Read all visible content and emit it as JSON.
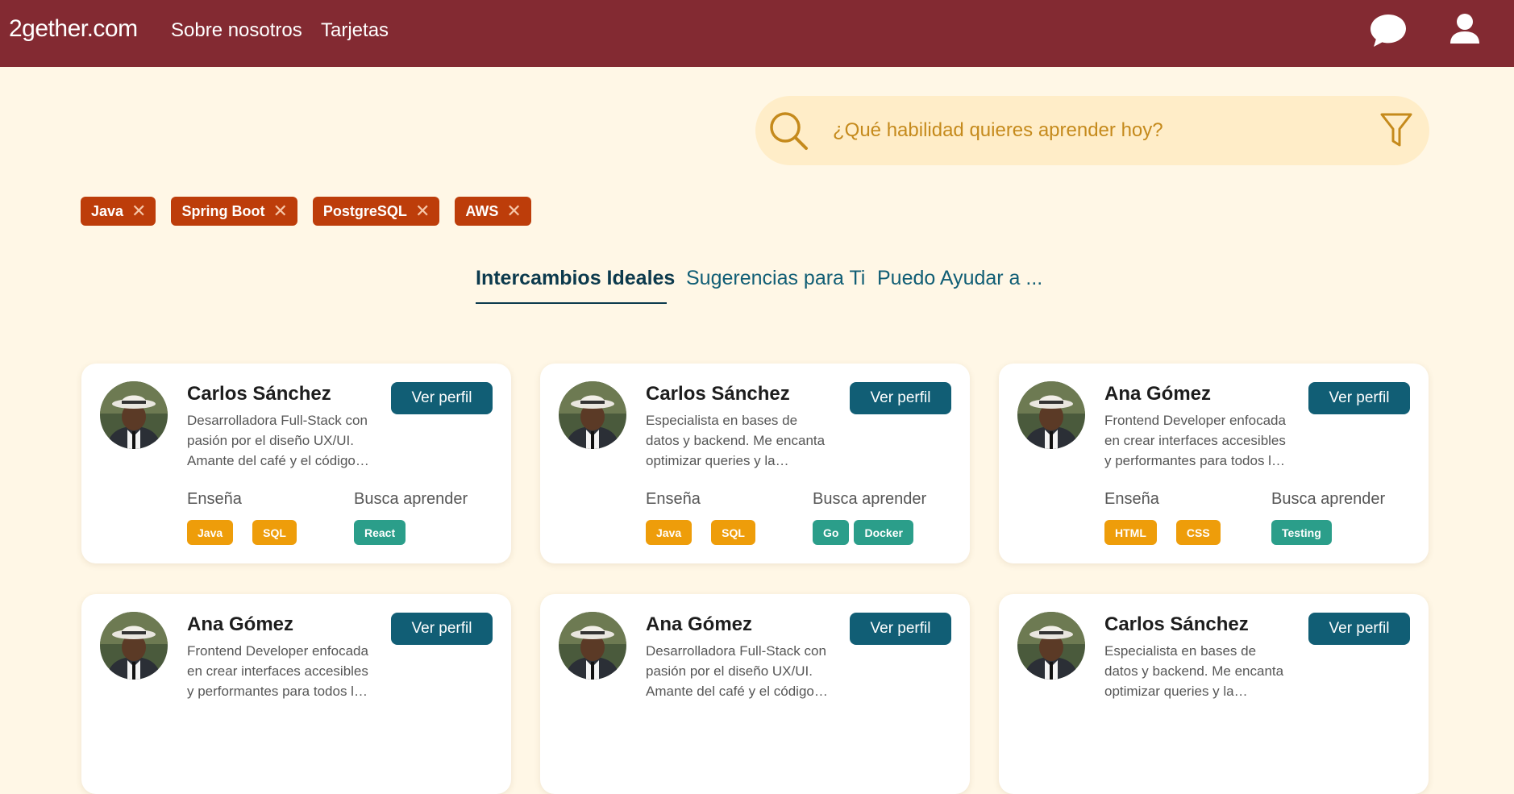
{
  "header": {
    "brand": "2gether.com",
    "nav": [
      "Sobre nosotros",
      "Tarjetas"
    ],
    "icons": [
      "chat-icon",
      "user-icon"
    ]
  },
  "search": {
    "placeholder": "¿Qué habilidad quieres aprender hoy?",
    "value": ""
  },
  "chips": [
    "Java",
    "Spring Boot",
    "PostgreSQL",
    "AWS"
  ],
  "tabs": [
    {
      "label": "Intercambios Ideales",
      "active": true
    },
    {
      "label": "Sugerencias para Ti",
      "active": false
    },
    {
      "label": "Puedo Ayudar a ...",
      "active": false
    }
  ],
  "labels": {
    "teach": "Enseña",
    "learn": "Busca aprender",
    "button": "Ver perfil"
  },
  "cards": [
    {
      "name": "Carlos Sánchez",
      "desc": "Desarrolladora Full-Stack con pasión por el diseño UX/UI. Amante del café y el código…",
      "teach": [
        "Java",
        "SQL"
      ],
      "learn": [
        "React"
      ]
    },
    {
      "name": "Carlos Sánchez",
      "desc": "Especialista en bases de datos y backend. Me encanta optimizar queries y la…",
      "teach": [
        "Java",
        "SQL"
      ],
      "learn": [
        "Go",
        "Docker"
      ]
    },
    {
      "name": "Ana Gómez",
      "desc": "Frontend Developer enfocada en crear interfaces accesibles y performantes para todos l…",
      "teach": [
        "HTML",
        "CSS"
      ],
      "learn": [
        "Testing"
      ]
    },
    {
      "name": "Ana Gómez",
      "desc": "Frontend Developer enfocada en crear interfaces accesibles y performantes para todos l…",
      "teach": [],
      "learn": []
    },
    {
      "name": "Ana Gómez",
      "desc": "Desarrolladora Full-Stack con pasión por el diseño UX/UI. Amante del café y el código…",
      "teach": [],
      "learn": []
    },
    {
      "name": "Carlos Sánchez",
      "desc": "Especialista en bases de datos y backend. Me encanta optimizar queries y la…",
      "teach": [],
      "learn": []
    }
  ],
  "colors": {
    "header_bg": "#832a32",
    "page_bg": "#fff7e6",
    "search_bg": "#ffedc8",
    "chip_bg": "#bd3d0a",
    "primary_button": "#115e75",
    "teach_tag": "#ee9d0a",
    "learn_tag": "#2b9e8a"
  }
}
